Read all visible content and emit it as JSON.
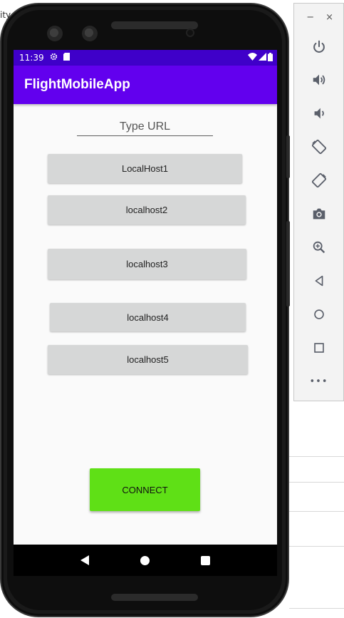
{
  "app": {
    "title": "FlightMobileApp"
  },
  "status_bar": {
    "time": "11:39",
    "icons": [
      "gear-icon",
      "sd-card-icon",
      "wifi-icon",
      "signal-icon",
      "battery-icon"
    ]
  },
  "url_input": {
    "placeholder": "Type URL",
    "value": ""
  },
  "hosts": [
    {
      "label": "LocalHost1"
    },
    {
      "label": "localhost2"
    },
    {
      "label": "localhost3"
    },
    {
      "label": "localhost4"
    },
    {
      "label": "localhost5"
    }
  ],
  "connect": {
    "label": "CONNECT"
  },
  "nav_bar": {
    "icons": [
      "back-icon",
      "home-icon",
      "recents-icon"
    ]
  },
  "emulator_toolbar": {
    "window_controls": [
      "−",
      "×"
    ],
    "items": [
      "power-icon",
      "volume-up-icon",
      "volume-down-icon",
      "rotate-left-icon",
      "rotate-right-icon",
      "camera-icon",
      "zoom-icon",
      "back-icon",
      "home-icon",
      "overview-icon",
      "more-icon"
    ],
    "more_label": "•••"
  },
  "background": {
    "fragment_top": "ity"
  },
  "colors": {
    "status_bar": "#3f00c9",
    "app_bar": "#6200ee",
    "host_button": "#d6d7d7",
    "connect_button": "#5fe016"
  }
}
